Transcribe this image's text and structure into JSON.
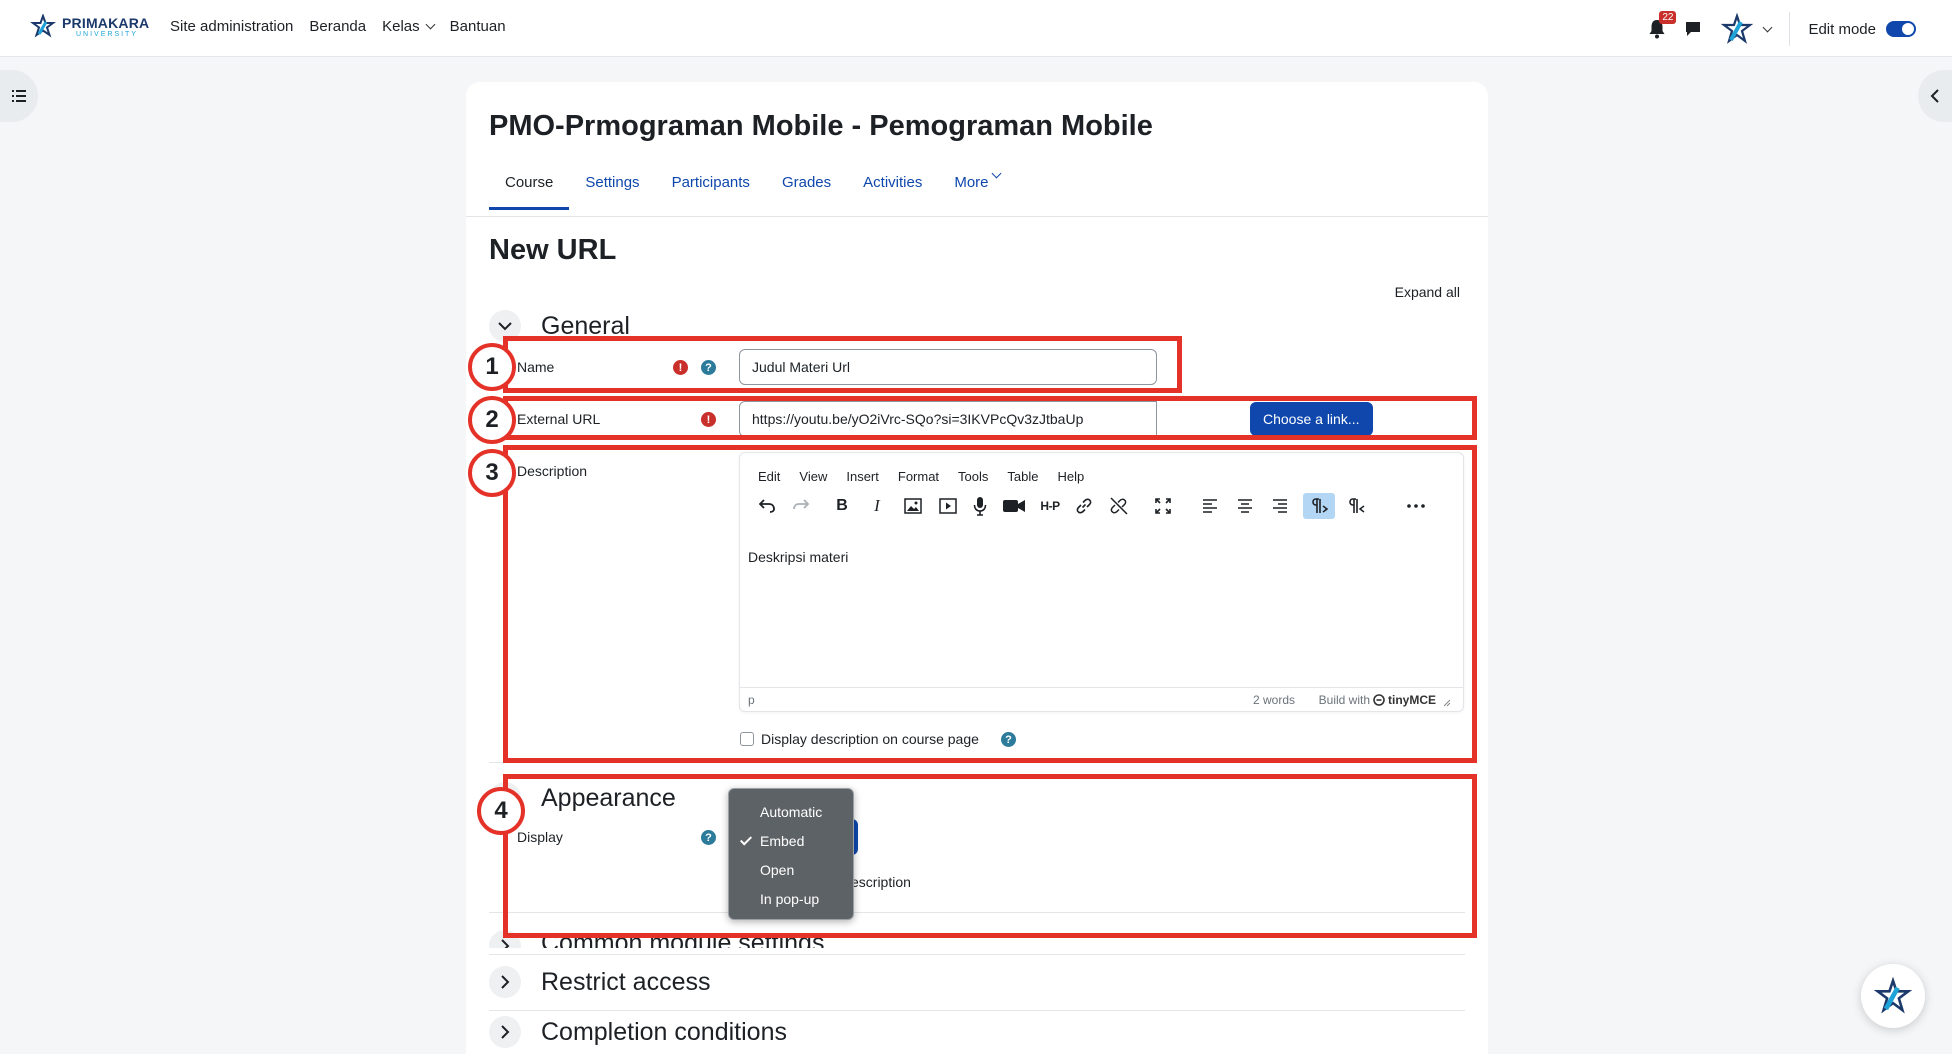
{
  "brand": {
    "name": "PRIMAKARA",
    "sub": "UNIVERSITY"
  },
  "nav": {
    "links": [
      {
        "label": "Site administration"
      },
      {
        "label": "Beranda"
      },
      {
        "label": "Kelas"
      },
      {
        "label": "Bantuan"
      }
    ],
    "notification_count": "22",
    "edit_mode_label": "Edit mode",
    "edit_mode_on": true
  },
  "course": {
    "title": "PMO-Prmograman Mobile - Pemograman Mobile",
    "tabs": [
      {
        "label": "Course",
        "active": true
      },
      {
        "label": "Settings"
      },
      {
        "label": "Participants"
      },
      {
        "label": "Grades"
      },
      {
        "label": "Activities"
      },
      {
        "label": "More"
      }
    ]
  },
  "page": {
    "heading": "New URL",
    "expand_all": "Expand all"
  },
  "general": {
    "title": "General",
    "name_label": "Name",
    "name_value": "Judul Materi Url",
    "url_label": "External URL",
    "url_value": "https://youtu.be/yO2iVrc-SQo?si=3IKVPcQv3zJtbaUp",
    "choose_link": "Choose a link...",
    "description_label": "Description",
    "editor_menu": [
      "Edit",
      "View",
      "Insert",
      "Format",
      "Tools",
      "Table",
      "Help"
    ],
    "editor_content": "Deskripsi materi",
    "editor_path": "p",
    "editor_words": "2 words",
    "editor_build": "Build with",
    "editor_brand": "tinyMCE",
    "display_desc_label": "Display description on course page"
  },
  "appearance": {
    "title": "Appearance",
    "display_label": "Display",
    "options": [
      "Automatic",
      "Embed",
      "Open",
      "In pop-up"
    ],
    "selected": "Embed",
    "partial_text": "escription"
  },
  "sections": {
    "common": "Common module settings",
    "restrict": "Restrict access",
    "completion": "Completion conditions"
  },
  "annotations": [
    "1",
    "2",
    "3",
    "4"
  ],
  "colors": {
    "primary": "#0f47ad",
    "annotation": "#e53228",
    "error": "#c9302c",
    "help": "#2c7b9b"
  }
}
